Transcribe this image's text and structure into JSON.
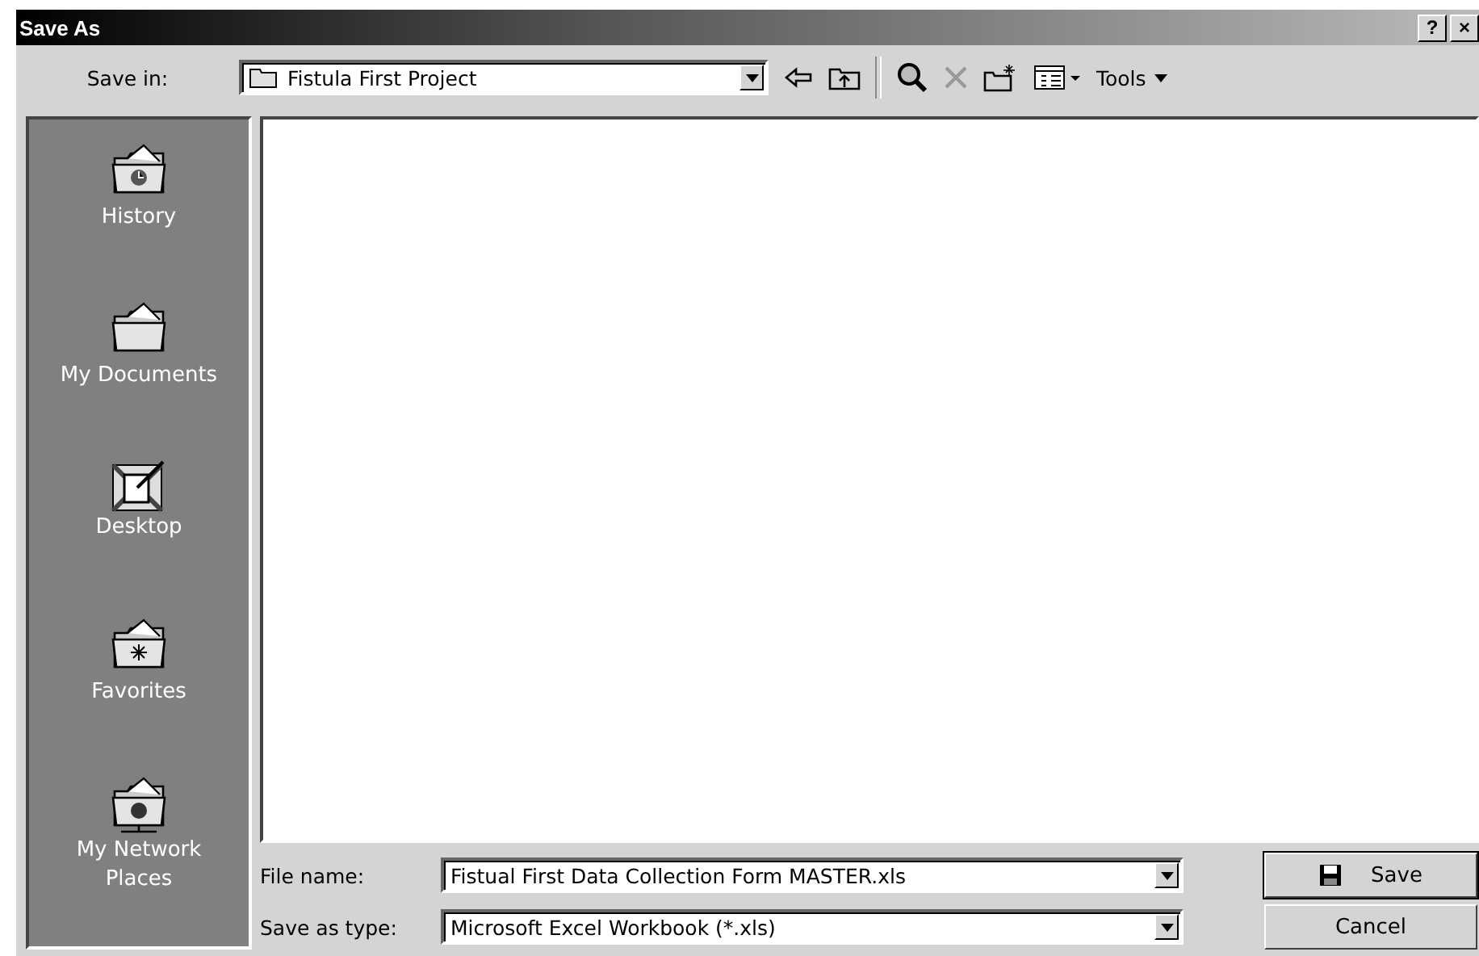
{
  "window": {
    "title": "Save As",
    "help_button": "?",
    "close_button": "×"
  },
  "save_in": {
    "label": "Save in:",
    "value": "Fistula First Project"
  },
  "toolbar": {
    "tools_label": "Tools"
  },
  "places": [
    {
      "label": "History",
      "kind": "history"
    },
    {
      "label": "My Documents",
      "kind": "documents"
    },
    {
      "label": "Desktop",
      "kind": "desktop"
    },
    {
      "label": "Favorites",
      "kind": "favorites"
    },
    {
      "label": "My Network Places",
      "kind": "network"
    }
  ],
  "file_name": {
    "label": "File name:",
    "value": "Fistual First Data Collection Form MASTER.xls"
  },
  "file_type": {
    "label": "Save as type:",
    "value": "Microsoft Excel Workbook (*.xls)"
  },
  "buttons": [
    {
      "label": "Save",
      "kind": "save"
    },
    {
      "label": "Cancel",
      "kind": "cancel"
    }
  ]
}
